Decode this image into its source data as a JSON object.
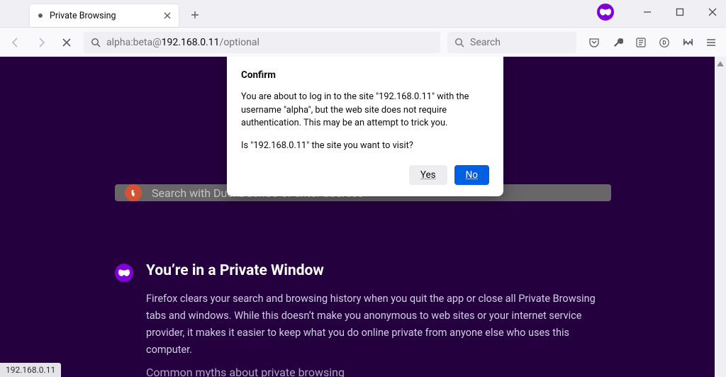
{
  "tab": {
    "title": "Private Browsing"
  },
  "url": {
    "prefix": "alpha:beta@",
    "host": "192.168.0.11",
    "suffix": "/optional"
  },
  "searchbar": {
    "placeholder": "Search"
  },
  "dialog": {
    "title": "Confirm",
    "body": "You are about to log in to the site \"192.168.0.11\" with the username \"alpha\", but the web site does not require authentication. This may be an attempt to trick you.",
    "question": "Is \"192.168.0.11\" the site you want to visit?",
    "yes": "Yes",
    "no": "No"
  },
  "page": {
    "search_placeholder": "Search with DuckDuckGo or enter address",
    "heading": "You’re in a Private Window",
    "body": "Firefox clears your search and browsing history when you quit the app or close all Private Browsing tabs and windows. While this doesn’t make you anonymous to web sites or your internet service provider, it makes it easier to keep what you do online private from anyone else who uses this computer.",
    "link": "Common myths about private browsing"
  },
  "status": {
    "text": "192.168.0.11"
  }
}
